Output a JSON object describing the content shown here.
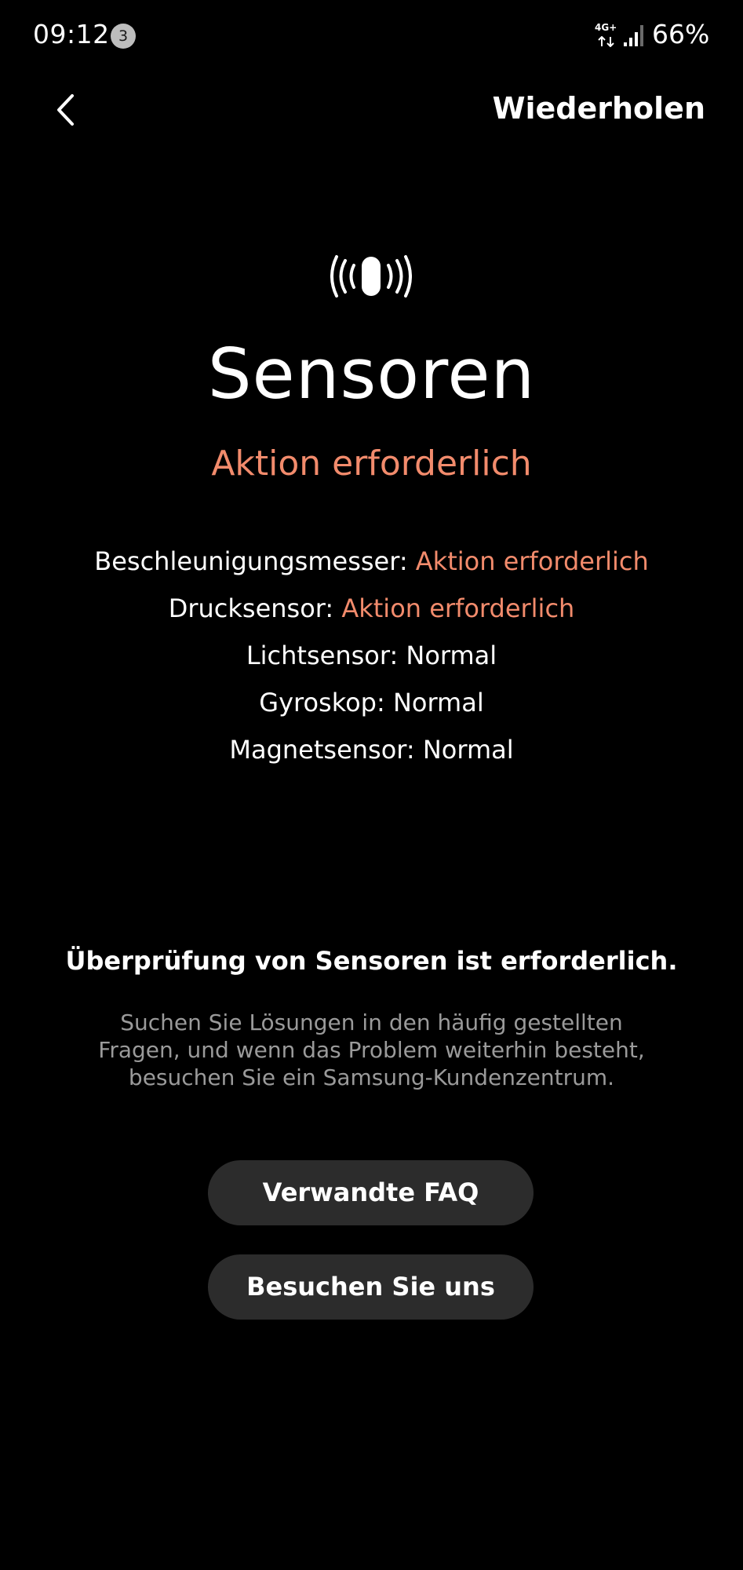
{
  "status_bar": {
    "time": "09:12",
    "notification_count": "3",
    "network_type": "4G+",
    "battery": "66%"
  },
  "header": {
    "back_icon": "chevron-left-icon",
    "retry_label": "Wiederholen"
  },
  "main": {
    "icon": "vibration-sensor-icon",
    "title": "Sensoren",
    "overall_status": "Aktion erforderlich",
    "sensors": [
      {
        "name": "Beschleunigungsmesser:",
        "status": "Aktion erforderlich"
      },
      {
        "name": "Drucksensor:",
        "status": "Aktion erforderlich"
      },
      {
        "name": "Lichtsensor:",
        "status": "Normal"
      },
      {
        "name": "Gyroskop:",
        "status": "Normal"
      },
      {
        "name": "Magnetsensor:",
        "status": "Normal"
      }
    ],
    "notice_title": "Überprüfung von Sensoren ist erforderlich.",
    "notice_body": "Suchen Sie Lösungen in den häufig gestellten Fragen, und wenn das Problem weiterhin besteht, besuchen Sie ein Samsung-Kundenzentrum."
  },
  "actions": {
    "faq_label": "Verwandte FAQ",
    "visit_label": "Besuchen Sie uns"
  },
  "colors": {
    "background": "#000000",
    "warning": "#f28b6c",
    "button_bg": "#2c2c2c",
    "secondary_text": "#9a9a9a"
  }
}
